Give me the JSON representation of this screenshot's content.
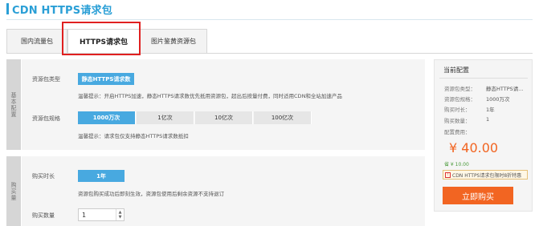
{
  "header": {
    "title": "CDN HTTPS请求包"
  },
  "tabs": [
    {
      "label": "国内流量包",
      "active": false
    },
    {
      "label": "HTTPS请求包",
      "active": true
    },
    {
      "label": "图片鉴黄资源包",
      "active": false
    }
  ],
  "section_basic": {
    "side_label": "基本配置",
    "type_label": "资源包类型",
    "type_value": "静态HTTPS请求数",
    "type_hint": "温馨提示：开启HTTPS加速，静态HTTPS请求数优先抵用资源包，超出后按量付费，同时适用CDN和全站加速产品",
    "spec_label": "资源包规格",
    "spec_options": [
      "1000万次",
      "1亿次",
      "10亿次",
      "100亿次"
    ],
    "spec_selected": "1000万次",
    "spec_hint": "温馨提示：请求包仅支持静态HTTPS请求数抵扣"
  },
  "section_purchase": {
    "side_label": "购买量",
    "duration_label": "购买时长",
    "duration_value": "1年",
    "duration_hint": "资源包购买成功后即刻生效，资源包使用后剩余资源不支持退订",
    "qty_label": "购买数量",
    "qty_value": "1"
  },
  "summary": {
    "title": "当前配置",
    "rows": [
      {
        "k": "资源包类型：",
        "v": "静态HTTPS请..."
      },
      {
        "k": "资源包规格：",
        "v": "1000万次"
      },
      {
        "k": "购买时长：",
        "v": "1年"
      },
      {
        "k": "购买数量：",
        "v": "1"
      }
    ],
    "fee_label": "配置费用：",
    "price": "¥ 40.00",
    "save": "省 ¥ 10.00",
    "promo": "CDN HTTPS请求包限时8折特惠",
    "buy_label": "立即购买"
  },
  "colors": {
    "accent": "#2a9fd6",
    "selected": "#48a9e0",
    "price": "#f26522",
    "highlight": "#e02020"
  }
}
